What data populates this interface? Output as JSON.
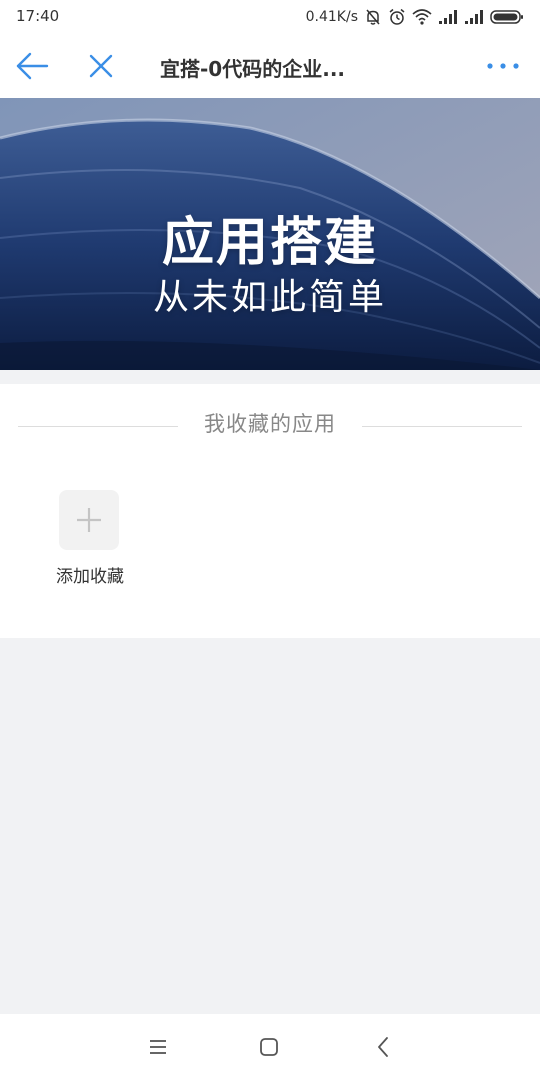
{
  "status_bar": {
    "time": "17:40",
    "network_speed": "0.41K/s",
    "icons": [
      "mute-bell-icon",
      "alarm-icon",
      "wifi-icon",
      "signal-icon",
      "signal-icon",
      "battery-icon"
    ]
  },
  "nav": {
    "title": "宜搭-0代码的企业...",
    "back_icon": "back-arrow-icon",
    "close_icon": "close-icon",
    "more_icon": "more-icon",
    "accent_color": "#3a8ee6"
  },
  "banner": {
    "title": "应用搭建",
    "subtitle": "从未如此简单"
  },
  "favorites": {
    "section_title": "我收藏的应用",
    "add_label": "添加收藏",
    "add_icon": "plus-icon"
  },
  "system_nav": {
    "icons": [
      "menu-icon",
      "home-icon",
      "back-icon"
    ]
  }
}
